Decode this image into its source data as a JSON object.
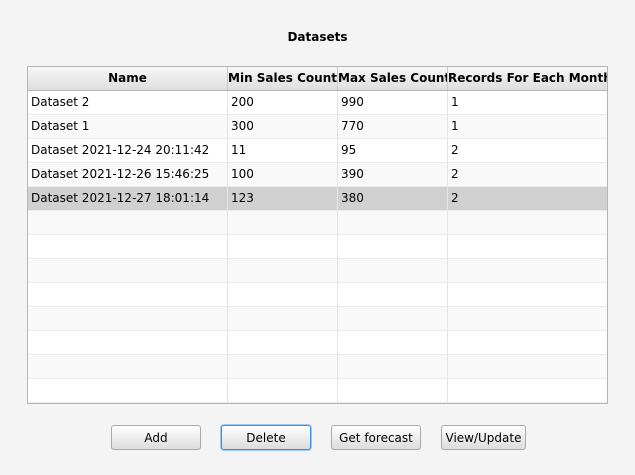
{
  "title": "Datasets",
  "table": {
    "columns": [
      "Name",
      "Min Sales Count",
      "Max Sales Count",
      "Records For Each Month"
    ],
    "rows": [
      [
        "Dataset 2",
        "200",
        "990",
        "1"
      ],
      [
        "Dataset 1",
        "300",
        "770",
        "1"
      ],
      [
        "Dataset 2021-12-24 20:11:42",
        "11",
        "95",
        "2"
      ],
      [
        "Dataset 2021-12-26 15:46:25",
        "100",
        "390",
        "2"
      ],
      [
        "Dataset 2021-12-27 18:01:14",
        "123",
        "380",
        "2"
      ]
    ],
    "selected_row": 4,
    "empty_rows": 8
  },
  "buttons": {
    "add": "Add",
    "delete": "Delete",
    "forecast": "Get forecast",
    "view_update": "View/Update"
  }
}
